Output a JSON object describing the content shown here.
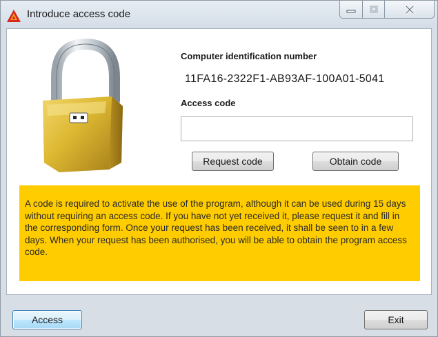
{
  "window": {
    "title": "Introduce access code",
    "controls": {
      "minimize": "minimize",
      "maximize": "maximize",
      "close": "close"
    }
  },
  "form": {
    "computer_id_label": "Computer identification number",
    "computer_id_value": "11FA16-2322F1-AB93AF-100A01-5041",
    "access_code_label": "Access code",
    "access_code_value": "",
    "request_button": "Request code",
    "obtain_button": "Obtain code"
  },
  "notice": {
    "text": "A code is required to activate the use of the program, although it can be used during 15 days without requiring an access code. If you have not yet received it, please request it and fill in the corresponding form. Once your request has been received, it shall be seen to in a few days. When your request has been authorised, you will be able to obtain the program access code."
  },
  "footer": {
    "access_button": "Access",
    "exit_button": "Exit"
  },
  "colors": {
    "notice_background": "#ffcc00",
    "window_frame": "#d7dee6",
    "app_icon": "#d9261c"
  },
  "icons": {
    "app": "warning-triangle-icon",
    "lock": "padlock-icon"
  }
}
